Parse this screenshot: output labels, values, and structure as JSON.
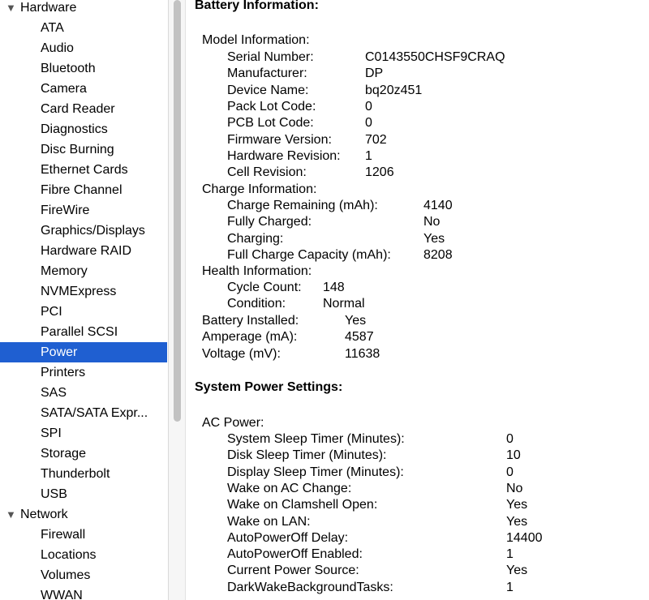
{
  "sidebar": {
    "groups": [
      {
        "label": "Hardware",
        "expanded": true
      },
      {
        "label": "Network",
        "expanded": true
      }
    ],
    "hardware_items": [
      "ATA",
      "Audio",
      "Bluetooth",
      "Camera",
      "Card Reader",
      "Diagnostics",
      "Disc Burning",
      "Ethernet Cards",
      "Fibre Channel",
      "FireWire",
      "Graphics/Displays",
      "Hardware RAID",
      "Memory",
      "NVMExpress",
      "PCI",
      "Parallel SCSI",
      "Power",
      "Printers",
      "SAS",
      "SATA/SATA Expr...",
      "SPI",
      "Storage",
      "Thunderbolt",
      "USB"
    ],
    "network_items": [
      "Firewall",
      "Locations",
      "Volumes",
      "WWAN"
    ],
    "selected": "Power"
  },
  "battery": {
    "title": "Battery Information:",
    "model_info": "Model Information:",
    "model": [
      {
        "k": "Serial Number:",
        "v": "C0143550CHSF9CRAQ"
      },
      {
        "k": "Manufacturer:",
        "v": "DP"
      },
      {
        "k": "Device Name:",
        "v": "bq20z451"
      },
      {
        "k": "Pack Lot Code:",
        "v": "0"
      },
      {
        "k": "PCB Lot Code:",
        "v": "0"
      },
      {
        "k": "Firmware Version:",
        "v": "702"
      },
      {
        "k": "Hardware Revision:",
        "v": "1"
      },
      {
        "k": "Cell Revision:",
        "v": "1206"
      }
    ],
    "charge_info": "Charge Information:",
    "charge": [
      {
        "k": "Charge Remaining (mAh):",
        "v": "4140"
      },
      {
        "k": "Fully Charged:",
        "v": "No"
      },
      {
        "k": "Charging:",
        "v": "Yes"
      },
      {
        "k": "Full Charge Capacity (mAh):",
        "v": "8208"
      }
    ],
    "health_info": "Health Information:",
    "health": [
      {
        "k": "Cycle Count:",
        "v": "148"
      },
      {
        "k": "Condition:",
        "v": "Normal"
      }
    ],
    "top": [
      {
        "k": "Battery Installed:",
        "v": "Yes"
      },
      {
        "k": "Amperage (mA):",
        "v": "4587"
      },
      {
        "k": "Voltage (mV):",
        "v": "11638"
      }
    ]
  },
  "power": {
    "title": "System Power Settings:",
    "ac_power": "AC Power:",
    "ac": [
      {
        "k": "System Sleep Timer (Minutes):",
        "v": "0"
      },
      {
        "k": "Disk Sleep Timer (Minutes):",
        "v": "10"
      },
      {
        "k": "Display Sleep Timer (Minutes):",
        "v": "0"
      },
      {
        "k": "Wake on AC Change:",
        "v": "No"
      },
      {
        "k": "Wake on Clamshell Open:",
        "v": "Yes"
      },
      {
        "k": "Wake on LAN:",
        "v": "Yes"
      },
      {
        "k": "AutoPowerOff Delay:",
        "v": "14400"
      },
      {
        "k": "AutoPowerOff Enabled:",
        "v": "1"
      },
      {
        "k": "Current Power Source:",
        "v": "Yes"
      },
      {
        "k": "DarkWakeBackgroundTasks:",
        "v": "1"
      }
    ]
  }
}
